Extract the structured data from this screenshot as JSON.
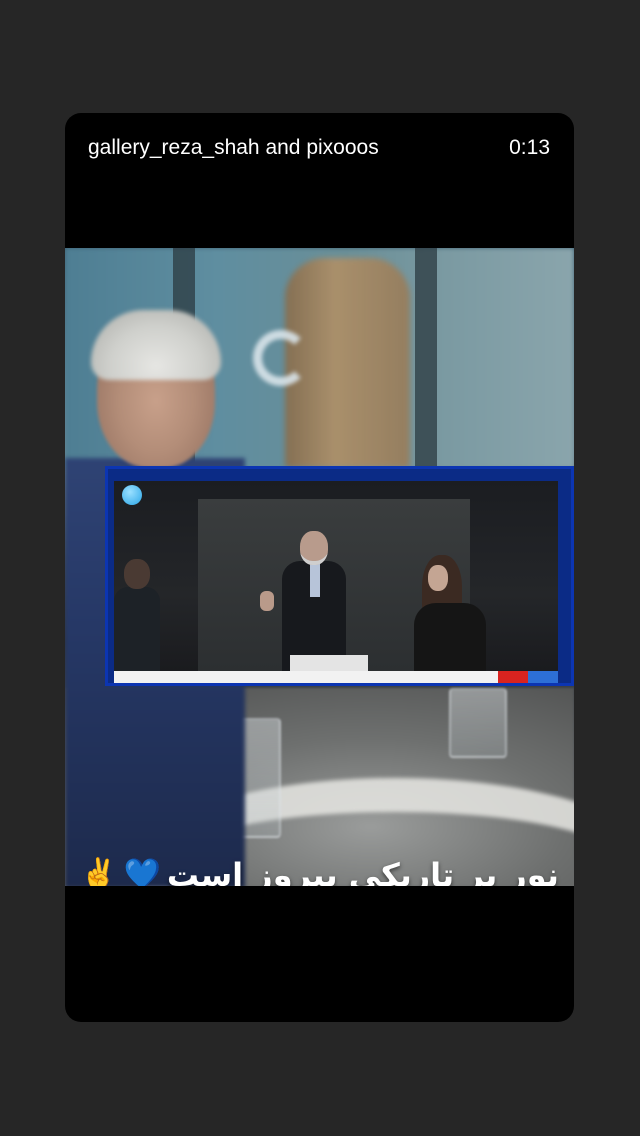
{
  "story": {
    "author_line": "gallery_reza_shah and pixooos",
    "timestamp": "0:13",
    "caption": "نور بر تاریکی پیروز است",
    "caption_emojis": [
      "💙",
      "✌️"
    ]
  }
}
